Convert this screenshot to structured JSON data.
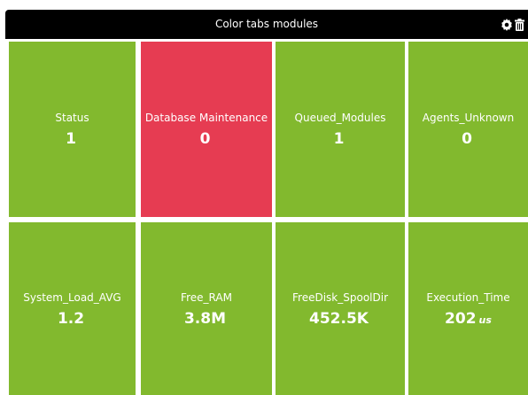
{
  "header": {
    "title": "Color tabs modules",
    "icons": [
      "gear-icon",
      "trash-icon"
    ]
  },
  "colors": {
    "ok": "#82b92e",
    "critical": "#e63c52",
    "header_bg": "#000000",
    "text": "#ffffff"
  },
  "modules": [
    {
      "label": "Status",
      "value": "1",
      "unit": "",
      "status": "ok"
    },
    {
      "label": "Database Maintenance",
      "value": "0",
      "unit": "",
      "status": "critical"
    },
    {
      "label": "Queued_Modules",
      "value": "1",
      "unit": "",
      "status": "ok"
    },
    {
      "label": "Agents_Unknown",
      "value": "0",
      "unit": "",
      "status": "ok"
    },
    {
      "label": "System_Load_AVG",
      "value": "1.2",
      "unit": "",
      "status": "ok"
    },
    {
      "label": "Free_RAM",
      "value": "3.8M",
      "unit": "",
      "status": "ok"
    },
    {
      "label": "FreeDisk_SpoolDir",
      "value": "452.5K",
      "unit": "",
      "status": "ok"
    },
    {
      "label": "Execution_Time",
      "value": "202",
      "unit": "us",
      "status": "ok"
    }
  ]
}
